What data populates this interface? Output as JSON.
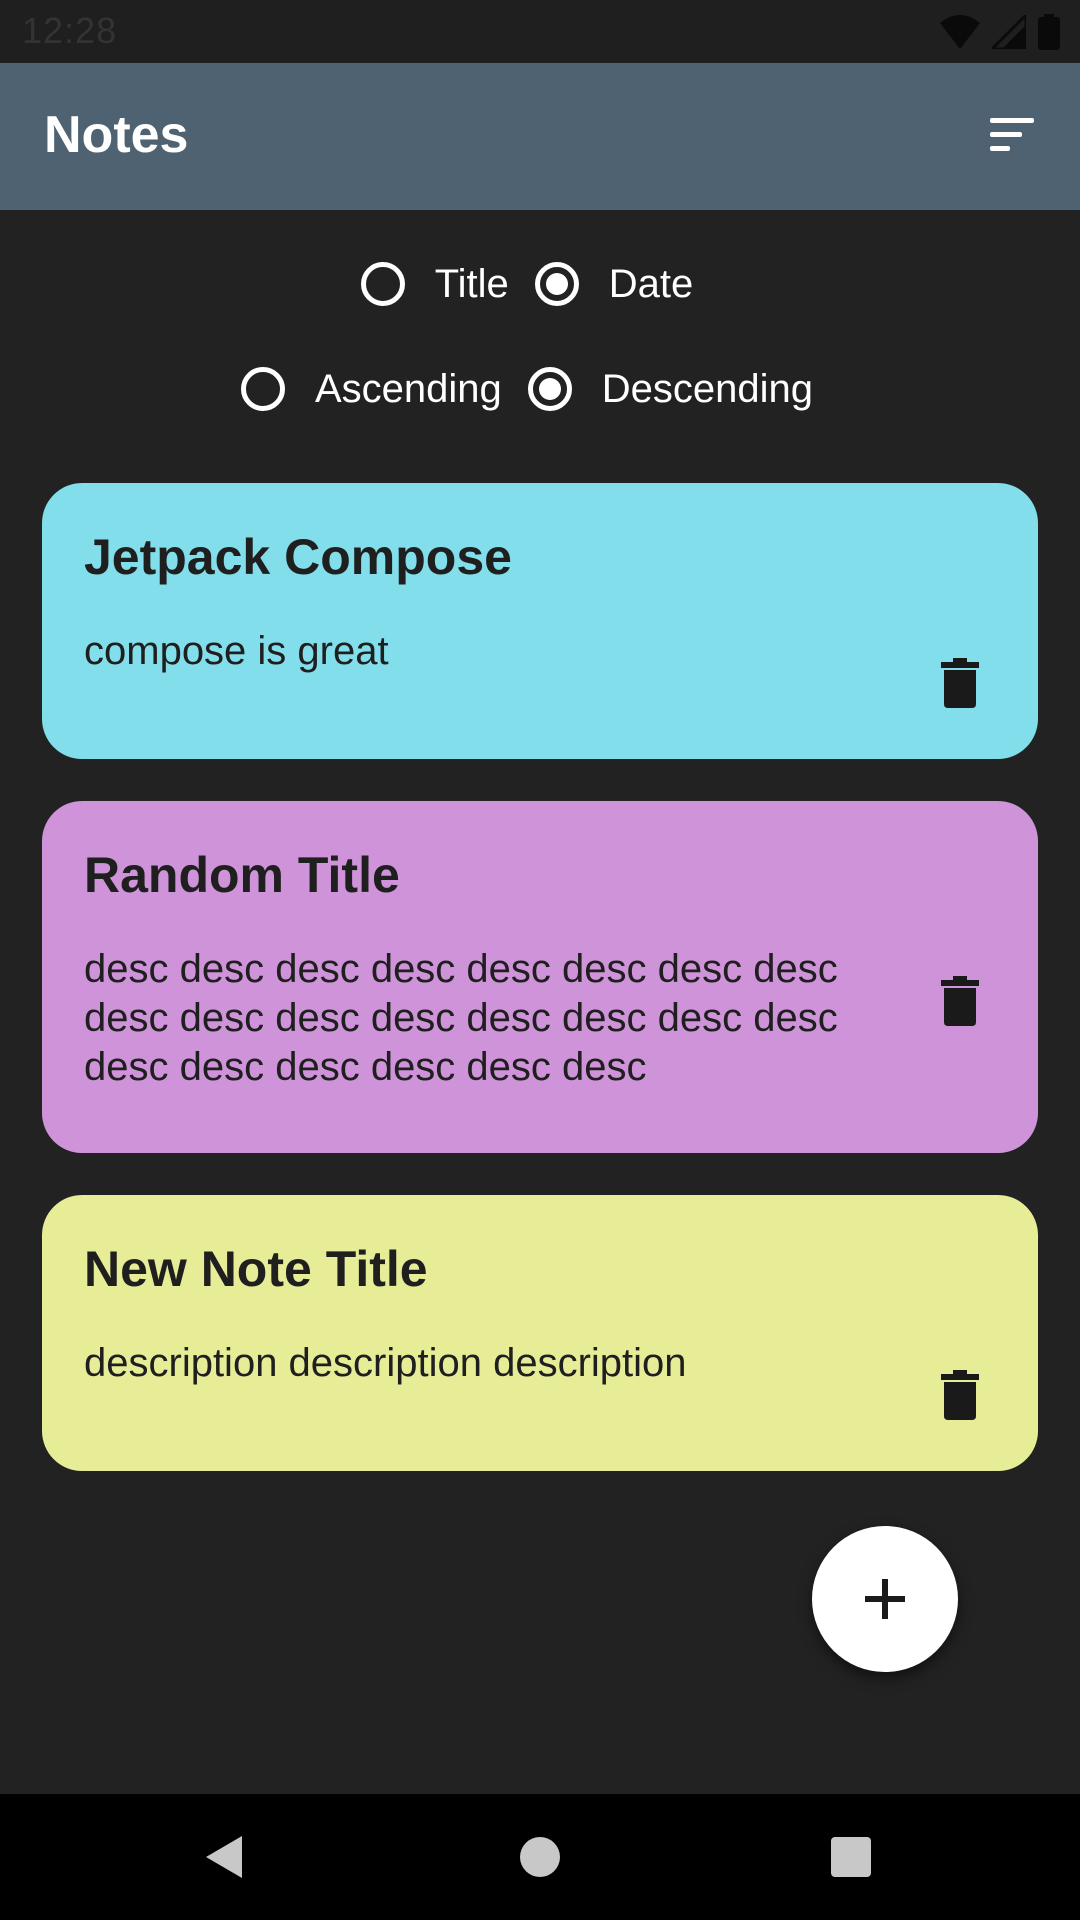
{
  "status_bar": {
    "time": "12:28",
    "icons": [
      "wifi-icon",
      "signal-icon",
      "battery-icon"
    ]
  },
  "app_bar": {
    "title": "Notes",
    "sort_icon": "sort-icon",
    "background": "#4f6272"
  },
  "sort_options": {
    "order_by": [
      {
        "label": "Title",
        "selected": false
      },
      {
        "label": "Date",
        "selected": true
      }
    ],
    "direction": [
      {
        "label": "Ascending",
        "selected": false
      },
      {
        "label": "Descending",
        "selected": true
      }
    ]
  },
  "notes": [
    {
      "title": "Jetpack Compose",
      "description": "compose is great",
      "color": "#81deea",
      "delete_icon": "trash-icon"
    },
    {
      "title": "Random Title",
      "description": "desc desc desc desc desc desc desc desc desc desc desc desc desc desc desc desc desc desc desc desc desc desc",
      "color": "#ce93d8",
      "delete_icon": "trash-icon"
    },
    {
      "title": "New Note Title",
      "description": "description description description",
      "color": "#e7ec97",
      "delete_icon": "trash-icon"
    }
  ],
  "fab": {
    "icon": "plus-icon"
  },
  "nav_bar": {
    "buttons": [
      "back-icon",
      "home-icon",
      "recents-icon"
    ]
  }
}
